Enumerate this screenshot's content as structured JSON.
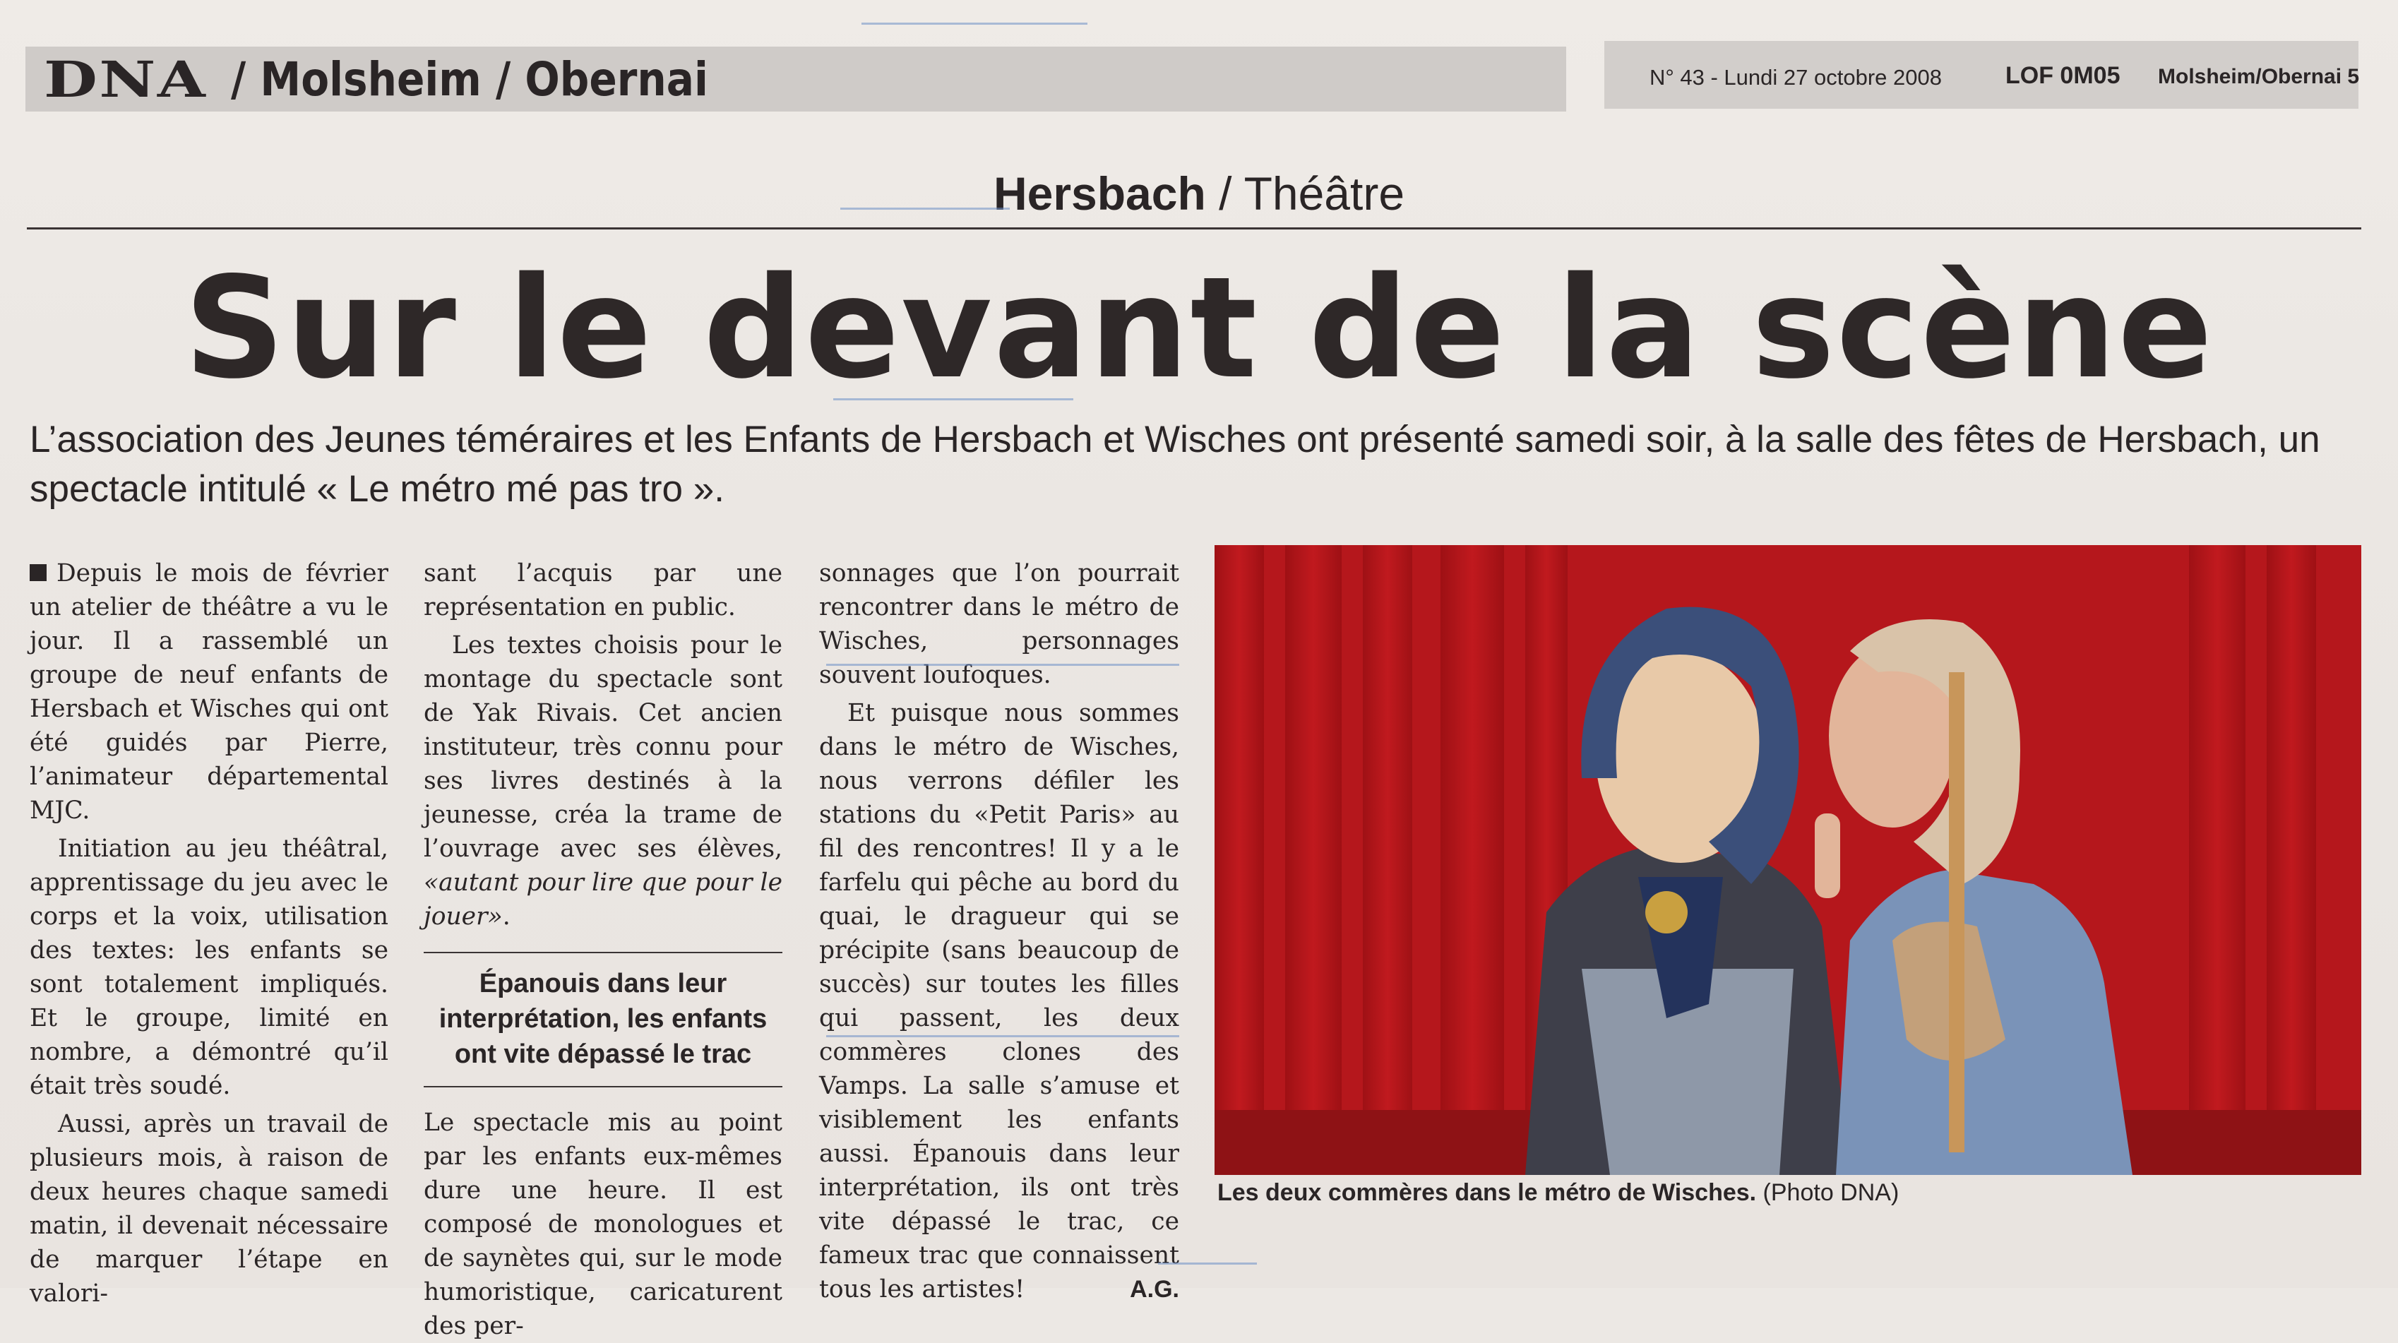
{
  "header": {
    "logo": "DNA",
    "section": "/ Molsheim / Obernai",
    "issue": "N° 43 - Lundi 27 octobre 2008",
    "edition_code": "LOF 0M05",
    "page": "Molsheim/Obernai 5"
  },
  "article": {
    "kicker_place": "Hersbach",
    "kicker_topic": " / Théâtre",
    "headline": "Sur le devant de la scène",
    "chapeau": "L’association des Jeunes téméraires et les Enfants de Hersbach et Wisches ont présenté samedi soir, à la salle des fêtes de Hersbach, un spectacle intitulé « Le métro mé pas tro ».",
    "col1": [
      "Depuis le mois de février un atelier de théâtre a vu le jour. Il a rassemblé un groupe de neuf enfants de Hersbach et Wisches qui ont été guidés par Pierre, l’animateur départemental MJC.",
      "Initiation au jeu théâtral, apprentissage du jeu avec le corps et la voix, utilisation des textes: les enfants se sont totalement impliqués. Et le groupe, limité en nombre, a démontré qu’il était très soudé.",
      "Aussi, après un travail de plusieurs mois, à raison de deux heures chaque samedi matin, il devenait nécessaire de marquer l’étape en valori-"
    ],
    "col2_lead": "sant l’acquis par une représentation en public.",
    "col2_p2_start": "Les textes choisis pour le montage du spectacle sont de Yak Rivais. Cet ancien instituteur, très connu pour ses livres destinés à la jeunesse, créa la trame de l’ouvrage avec ses élèves, ",
    "col2_p2_quote": "«autant pour lire que pour le jouer»",
    "col2_p2_end": ".",
    "intertitle": "Épanouis dans leur interprétation, les enfants ont vite dépassé le trac",
    "col2_p3": "Le spectacle mis au point par les enfants eux-mêmes dure une heure. Il est composé de monologues et de saynètes qui, sur le mode humoristique, caricaturent des per-",
    "col3": [
      "sonnages que l’on pourrait rencontrer dans le métro de Wisches, personnages souvent loufoques.",
      "Et puisque nous sommes dans le métro de Wisches, nous verrons défiler les stations du «Petit Paris» au fil des rencontres! Il y a le farfelu qui pêche au bord du quai, le dragueur qui se précipite (sans beaucoup de succès) sur toutes les filles qui passent, les deux commères clones des Vamps. La salle s’amuse et visiblement les enfants aussi. Épanouis dans leur interprétation, ils ont très vite dépassé le trac, ce fameux trac que connaissent tous les artistes!"
    ],
    "signature": "A.G.",
    "caption_bold": "Les deux commères dans le métro de Wisches.",
    "caption_credit": " (Photo DNA)"
  },
  "colors": {
    "paper": "#ece8e4",
    "header_bar": "#cfcbc8",
    "ink": "#2a2526",
    "curtain": "#b8181c",
    "marker": "#6e8fc7"
  }
}
